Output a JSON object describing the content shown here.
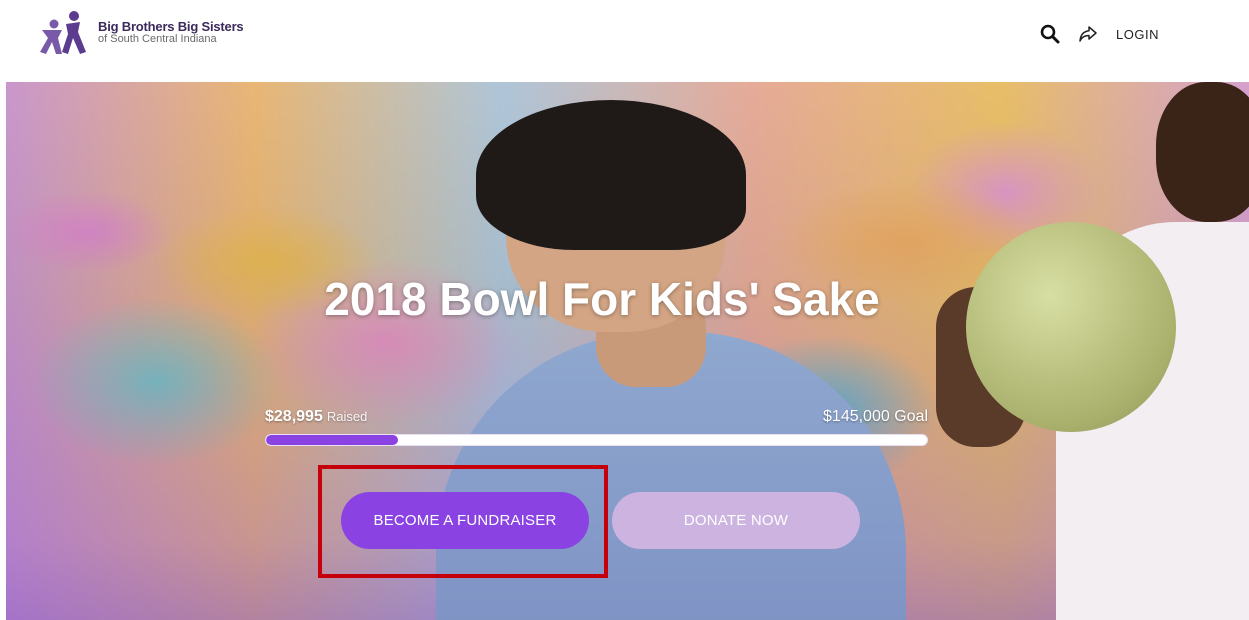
{
  "header": {
    "org_name": "Big Brothers Big Sisters",
    "org_sub": "of South Central Indiana",
    "login_label": "LOGIN",
    "icons": [
      "search-icon",
      "share-icon"
    ]
  },
  "hero": {
    "title": "2018 Bowl For Kids' Sake",
    "raised_amount": "$28,995",
    "raised_label": "Raised",
    "goal_text": "$145,000 Goal",
    "progress_fraction": 0.2,
    "fundraise_label": "BECOME A FUNDRAISER",
    "donate_label": "DONATE NOW"
  },
  "colors": {
    "accent": "#8a43e2",
    "donate": "#cdb4e0",
    "highlight": "#c6000b"
  }
}
